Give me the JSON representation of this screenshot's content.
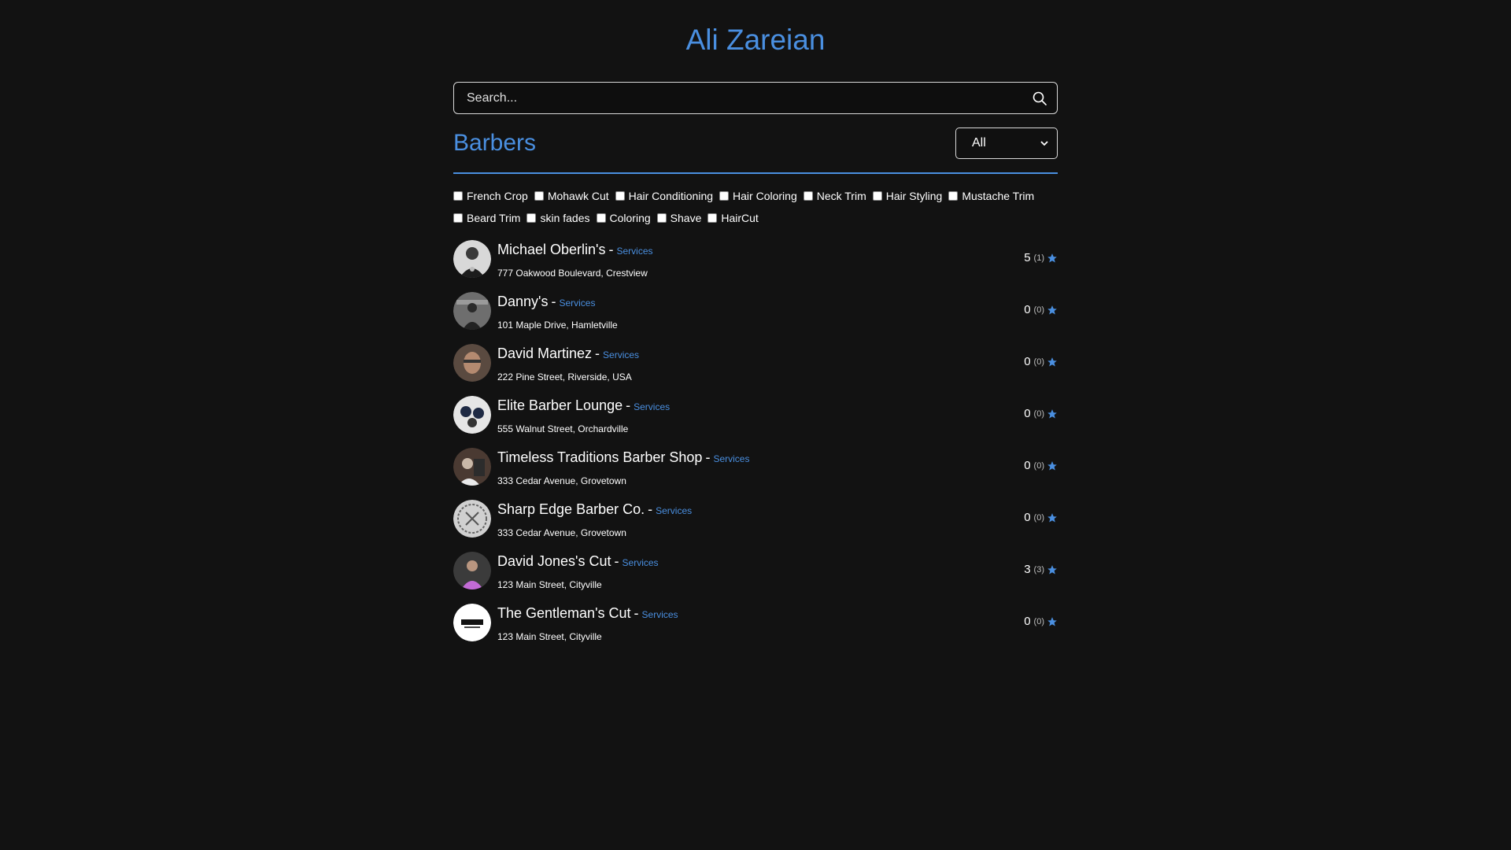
{
  "header": {
    "title": "Ali Zareian"
  },
  "search": {
    "placeholder": "Search..."
  },
  "section": {
    "title": "Barbers"
  },
  "filter_select": {
    "value": "All"
  },
  "service_filters": [
    "French Crop",
    "Mohawk Cut",
    "Hair Conditioning",
    "Hair Coloring",
    "Neck Trim",
    "Hair Styling",
    "Mustache Trim",
    "Beard Trim",
    "skin fades",
    "Coloring",
    "Shave",
    "HairCut"
  ],
  "barbers": [
    {
      "name": "Michael Oberlin's",
      "services_link": "Services",
      "address": "777 Oakwood Boulevard, Crestview",
      "rating": "5",
      "count": "(1)"
    },
    {
      "name": "Danny's",
      "services_link": "Services",
      "address": "101 Maple Drive, Hamletville",
      "rating": "0",
      "count": "(0)"
    },
    {
      "name": "David Martinez",
      "services_link": "Services",
      "address": "222 Pine Street, Riverside, USA",
      "rating": "0",
      "count": "(0)"
    },
    {
      "name": "Elite Barber Lounge",
      "services_link": "Services",
      "address": "555 Walnut Street, Orchardville",
      "rating": "0",
      "count": "(0)"
    },
    {
      "name": "Timeless Traditions Barber Shop",
      "services_link": "Services",
      "address": "333 Cedar Avenue, Grovetown",
      "rating": "0",
      "count": "(0)"
    },
    {
      "name": "Sharp Edge Barber Co.",
      "services_link": "Services",
      "address": "333 Cedar Avenue, Grovetown",
      "rating": "0",
      "count": "(0)"
    },
    {
      "name": "David Jones's Cut",
      "services_link": "Services",
      "address": "123 Main Street, Cityville",
      "rating": "3",
      "count": "(3)"
    },
    {
      "name": "The Gentleman's Cut",
      "services_link": "Services",
      "address": "123 Main Street, Cityville",
      "rating": "0",
      "count": "(0)"
    }
  ],
  "theme": {
    "accent": "#4a8fe0",
    "background": "#121212"
  }
}
